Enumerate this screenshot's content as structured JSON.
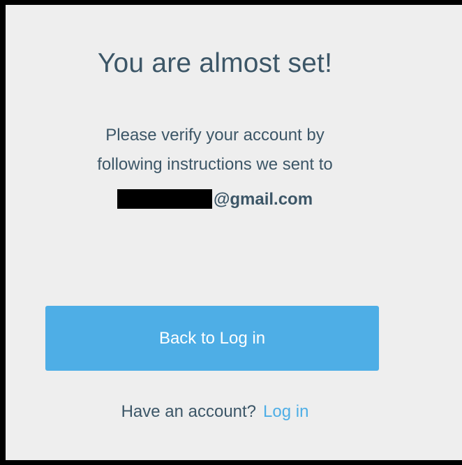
{
  "card": {
    "title": "You are almost set!",
    "message_line1": "Please verify your account by",
    "message_line2": "following instructions we sent to",
    "email_suffix": "@gmail.com",
    "button_label": "Back to Log in",
    "footer_text": "Have an account?",
    "footer_link": "Log in"
  },
  "colors": {
    "text": "#3c5667",
    "accent": "#4eaee6",
    "background": "#eeeeee",
    "border": "#000000"
  }
}
